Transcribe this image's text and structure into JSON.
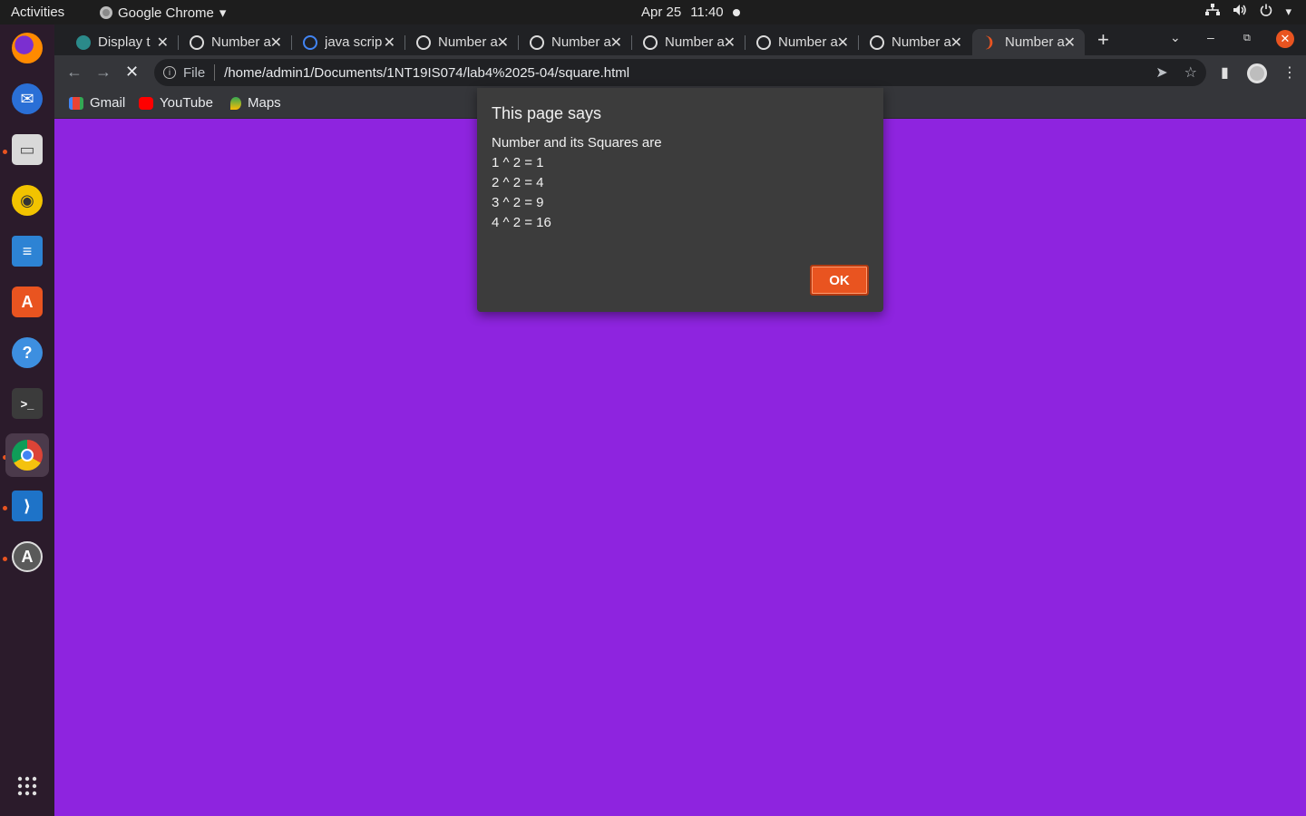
{
  "topbar": {
    "activities": "Activities",
    "app_name": "Google Chrome",
    "date": "Apr 25",
    "time": "11:40"
  },
  "dock": {
    "items": [
      {
        "name": "firefox",
        "icon": "firefox-icon"
      },
      {
        "name": "thunderbird",
        "icon": "mail-icon"
      },
      {
        "name": "files",
        "icon": "folder-icon"
      },
      {
        "name": "rhythmbox",
        "icon": "music-icon"
      },
      {
        "name": "writer",
        "icon": "document-icon"
      },
      {
        "name": "software",
        "icon": "store-icon"
      },
      {
        "name": "help",
        "icon": "help-icon"
      },
      {
        "name": "terminal",
        "icon": "terminal-icon"
      },
      {
        "name": "chrome",
        "icon": "chrome-icon"
      },
      {
        "name": "vscode",
        "icon": "code-icon"
      },
      {
        "name": "updater",
        "icon": "update-icon"
      }
    ],
    "show_apps_icon": "grid-icon"
  },
  "tabs": [
    {
      "title": "Display t"
    },
    {
      "title": "Number a"
    },
    {
      "title": "java scrip"
    },
    {
      "title": "Number a"
    },
    {
      "title": "Number a"
    },
    {
      "title": "Number a"
    },
    {
      "title": "Number a"
    },
    {
      "title": "Number a"
    },
    {
      "title": "Number a"
    }
  ],
  "toolbar": {
    "scheme": "File",
    "url": "/home/admin1/Documents/1NT19IS074/lab4%2025-04/square.html"
  },
  "bookmarks": [
    {
      "label": "Gmail"
    },
    {
      "label": "YouTube"
    },
    {
      "label": "Maps"
    }
  ],
  "dialog": {
    "heading": "This page says",
    "lines": [
      "Number and its Squares are",
      "1 ^ 2 = 1",
      "2 ^ 2 = 4",
      "3 ^ 2 = 9",
      "4 ^ 2 = 16"
    ],
    "ok_label": "OK"
  },
  "colors": {
    "page_background": "#8e24df",
    "accent": "#e95420"
  }
}
